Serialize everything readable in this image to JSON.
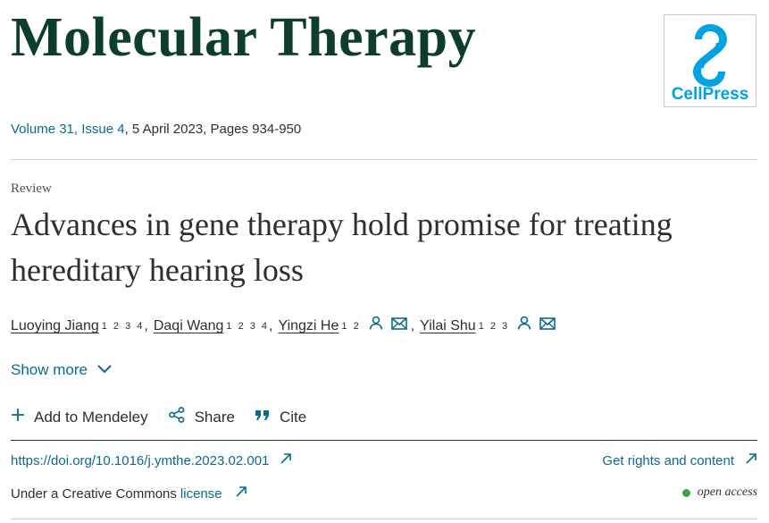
{
  "header": {
    "journal_title": "Molecular Therapy",
    "publisher_logo_text": "CellPress"
  },
  "issue": {
    "volume": "Volume 31, Issue 4",
    "rest": ", 5 April 2023, Pages 934-950"
  },
  "article": {
    "type": "Review",
    "title": "Advances in gene therapy hold promise for treating hereditary hearing loss"
  },
  "authors": [
    {
      "name": "Luoying Jiang",
      "affiliations": "1 2 3 4"
    },
    {
      "name": "Daqi Wang",
      "affiliations": "1 2 3 4"
    },
    {
      "name": "Yingzi He",
      "affiliations": "1 2"
    },
    {
      "name": "Yilai Shu",
      "affiliations": "1 2 3"
    }
  ],
  "show_more_label": "Show more",
  "actions": {
    "mendeley": "Add to Mendeley",
    "share": "Share",
    "cite": "Cite"
  },
  "doi": "https://doi.org/10.1016/j.ymthe.2023.02.001",
  "rights_label": "Get rights and content",
  "license": {
    "prefix": "Under a Creative Commons",
    "link": "license"
  },
  "open_access_label": "open access",
  "colors": {
    "journal_green": "#0c3d2e",
    "link_blue": "#0b6a8f",
    "cellpress_blue": "#00a3e0",
    "open_access_green": "#3ba54a"
  }
}
